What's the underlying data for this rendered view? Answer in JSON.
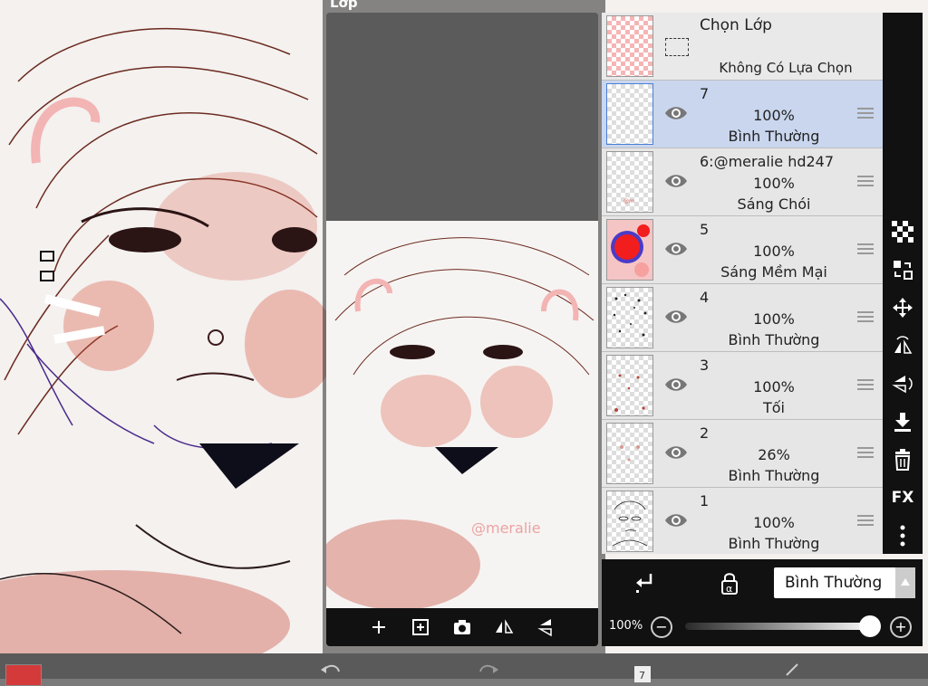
{
  "panel": {
    "title": "Lớp"
  },
  "select_layer": {
    "title": "Chọn Lớp",
    "subtitle": "Không Có Lựa Chọn"
  },
  "layers": [
    {
      "name": "7",
      "opacity": "100%",
      "mode": "Bình Thường",
      "selected": true
    },
    {
      "name": "6:@meralie hd247",
      "opacity": "100%",
      "mode": "Sáng Chói",
      "selected": false
    },
    {
      "name": "5",
      "opacity": "100%",
      "mode": "Sáng Mềm Mại",
      "selected": false
    },
    {
      "name": "4",
      "opacity": "100%",
      "mode": "Bình Thường",
      "selected": false
    },
    {
      "name": "3",
      "opacity": "100%",
      "mode": "Tối",
      "selected": false
    },
    {
      "name": "2",
      "opacity": "26%",
      "mode": "Bình Thường",
      "selected": false
    },
    {
      "name": "1",
      "opacity": "100%",
      "mode": "Bình Thường",
      "selected": false
    }
  ],
  "blend_mode": {
    "value": "Bình Thường"
  },
  "opacity": {
    "label": "100%",
    "minus": "−",
    "plus": "+",
    "level": 1.0
  },
  "right_tools": {
    "fx_label": "FX"
  },
  "colors": {
    "accent_selected": "#c9d6ee",
    "swatch": "#d43a3a",
    "toolbar": "#111111"
  }
}
